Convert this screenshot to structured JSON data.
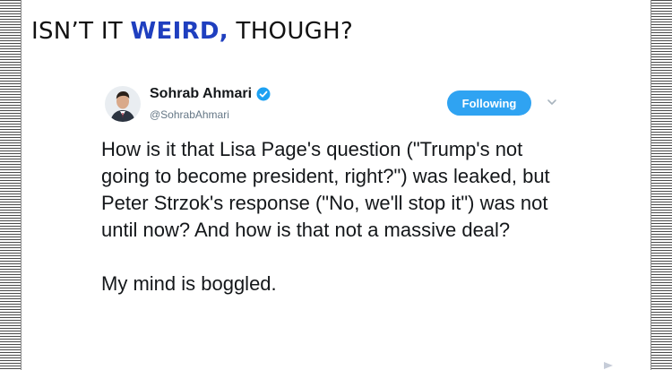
{
  "headline": {
    "prefix": "ISN’T IT ",
    "emphasis": "WEIRD,",
    "suffix": " THOUGH?",
    "accent_color": "#1f3fbf"
  },
  "tweet": {
    "display_name": "Sohrab Ahmari",
    "handle": "@SohrabAhmari",
    "verified_icon": "verified-badge-icon",
    "follow_button_label": "Following",
    "follow_button_color": "#2fa3f2",
    "menu_icon": "chevron-down-icon",
    "avatar_icon": "avatar-portrait",
    "body_paragraph_1": "How is it that Lisa Page's question (\"Trump's not going to become president, right?\") was leaked, but Peter Strzok's response (\"No, we'll stop it\") was not until now? And how is that not a massive deal?",
    "body_paragraph_2": "My mind is boggled."
  },
  "frame": {
    "border_style": "striped-film-edge",
    "corner_icon": "next-arrow-icon"
  }
}
